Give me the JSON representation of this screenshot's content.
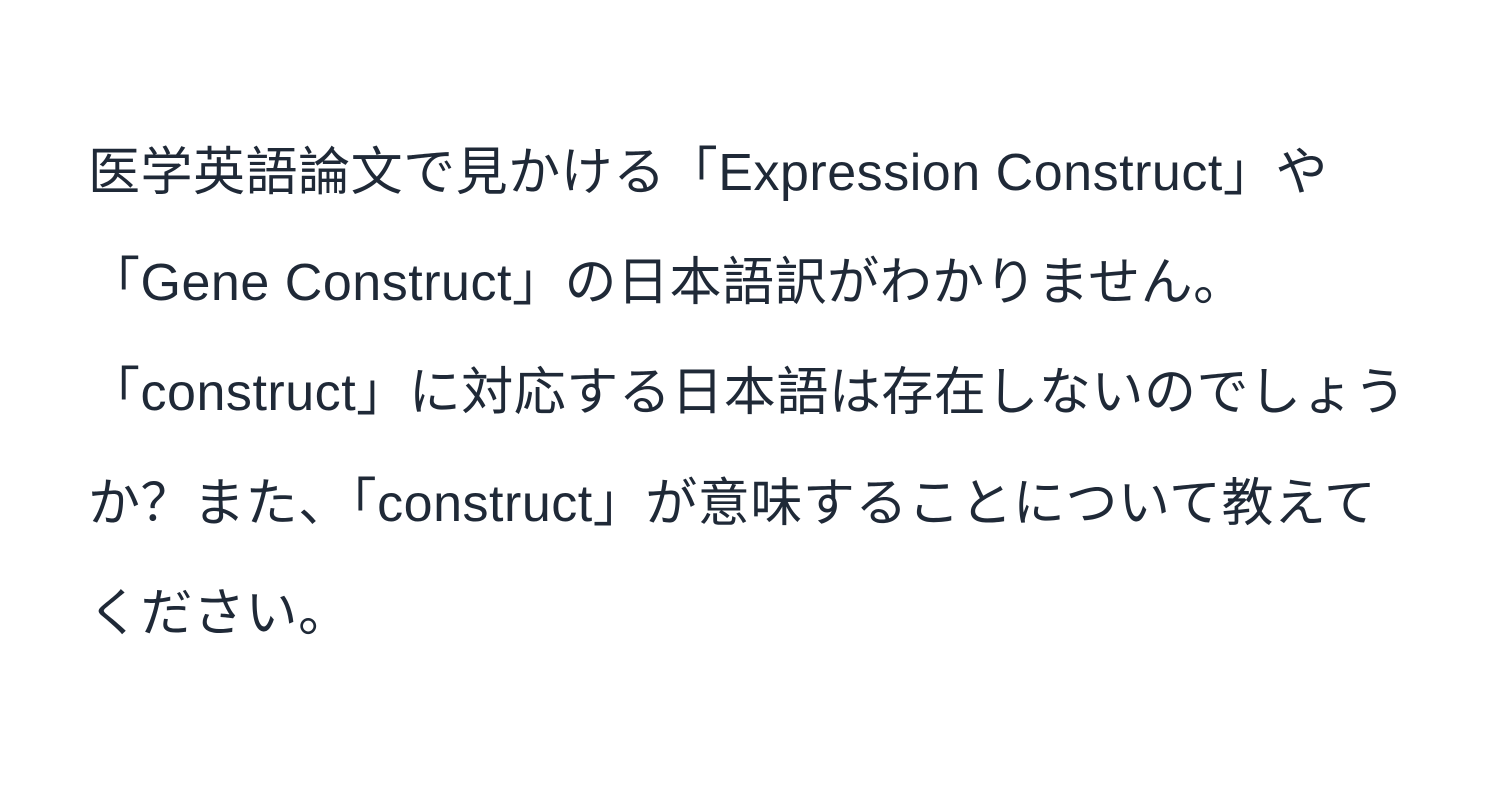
{
  "document": {
    "body": "医学英語論文で見かける「Expression Construct」や「Gene Construct」の日本語訳がわかりません。「construct」に対応する日本語は存在しないのでしょうか？また、「construct」が意味することについて教えてください。"
  }
}
